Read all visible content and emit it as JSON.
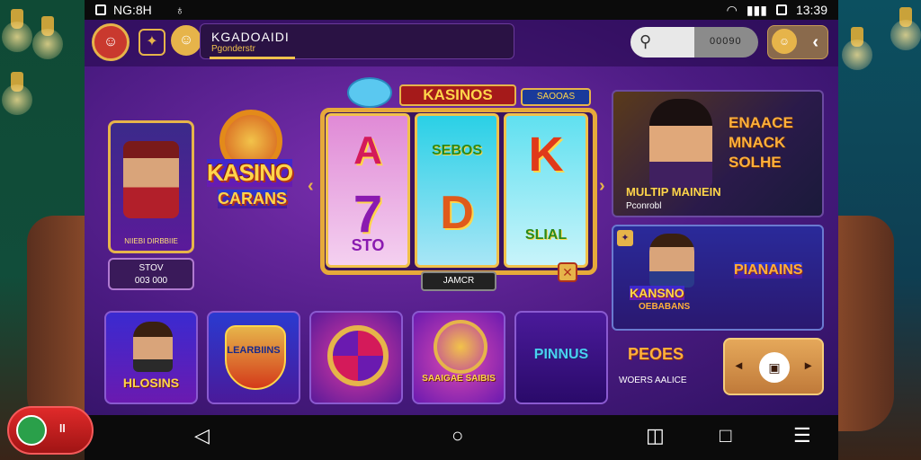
{
  "statusbar": {
    "network": "NG:8H",
    "time": "13:39"
  },
  "header": {
    "profile_name": "KGADOAIDI",
    "profile_sub": "Pgonderstr",
    "search_value": "00090"
  },
  "hero_card": {
    "caption": "NIIEBI DIRBBIIE",
    "box_line1": "STOV",
    "box_line2": "003 000"
  },
  "logo": {
    "line1": "KASINO",
    "line2": "CARANS"
  },
  "slot": {
    "title": "KASINOS",
    "badge": "SAOOAS",
    "reels": [
      {
        "top": "A",
        "bottom": "7",
        "bottom_sub": "STO"
      },
      {
        "top": "SEBOS",
        "bottom": "D"
      },
      {
        "top": "K",
        "bottom": "SLIAL"
      }
    ],
    "lever_label": "JAMCR"
  },
  "promo": {
    "headline_1": "ENAACE",
    "headline_2": "MNACK",
    "headline_3": "SOLHE",
    "title": "MULTIP MAINEIN",
    "subtitle": "Pconrobl"
  },
  "promo2": {
    "left_title": "KANSNO",
    "left_sub": "OEBABANS",
    "right_title": "PIANAINS"
  },
  "bottom_right": {
    "title": "PEOES",
    "subtitle": "WOERS AALICE"
  },
  "tiles": [
    {
      "label": "HLOSINS"
    },
    {
      "label": "LEARBIINS"
    },
    {
      "label": ""
    },
    {
      "label": "SAAIGAE SAIBIS"
    },
    {
      "label": "PINNUS"
    }
  ]
}
